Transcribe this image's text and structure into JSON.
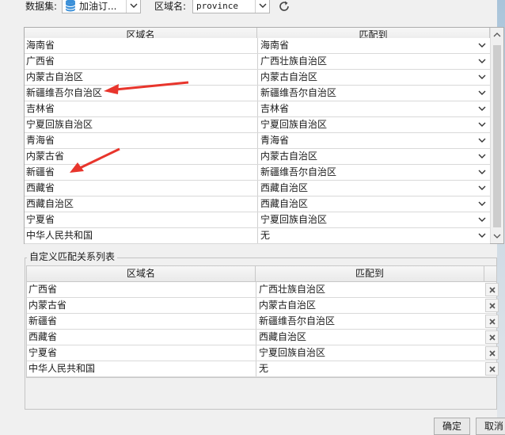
{
  "toolbar": {
    "dataset_label": "数据集:",
    "dataset_value": "加油订...",
    "region_label": "区域名:",
    "region_value": "province"
  },
  "mapping_table": {
    "headers": [
      "区域名",
      "匹配到"
    ],
    "rows": [
      {
        "region": "海南省",
        "match": "海南省"
      },
      {
        "region": "广西省",
        "match": "广西壮族自治区"
      },
      {
        "region": "内蒙古自治区",
        "match": "内蒙古自治区"
      },
      {
        "region": "新疆维吾尔自治区",
        "match": "新疆维吾尔自治区"
      },
      {
        "region": "吉林省",
        "match": "吉林省"
      },
      {
        "region": "宁夏回族自治区",
        "match": "宁夏回族自治区"
      },
      {
        "region": "青海省",
        "match": "青海省"
      },
      {
        "region": "内蒙古省",
        "match": "内蒙古自治区"
      },
      {
        "region": "新疆省",
        "match": "新疆维吾尔自治区"
      },
      {
        "region": "西藏省",
        "match": "西藏自治区"
      },
      {
        "region": "西藏自治区",
        "match": "西藏自治区"
      },
      {
        "region": "宁夏省",
        "match": "宁夏回族自治区"
      },
      {
        "region": "中华人民共和国",
        "match": "无"
      }
    ]
  },
  "custom_list": {
    "title": "自定义匹配关系列表",
    "headers": [
      "区域名",
      "匹配到"
    ],
    "rows": [
      {
        "region": "广西省",
        "match": "广西壮族自治区"
      },
      {
        "region": "内蒙古省",
        "match": "内蒙古自治区"
      },
      {
        "region": "新疆省",
        "match": "新疆维吾尔自治区"
      },
      {
        "region": "西藏省",
        "match": "西藏自治区"
      },
      {
        "region": "宁夏省",
        "match": "宁夏回族自治区"
      },
      {
        "region": "中华人民共和国",
        "match": "无"
      }
    ]
  },
  "buttons": {
    "ok": "确定",
    "cancel": "取消"
  },
  "colors": {
    "annotation_arrow": "#e8352c",
    "dataset_icon": "#3a8fd8"
  }
}
